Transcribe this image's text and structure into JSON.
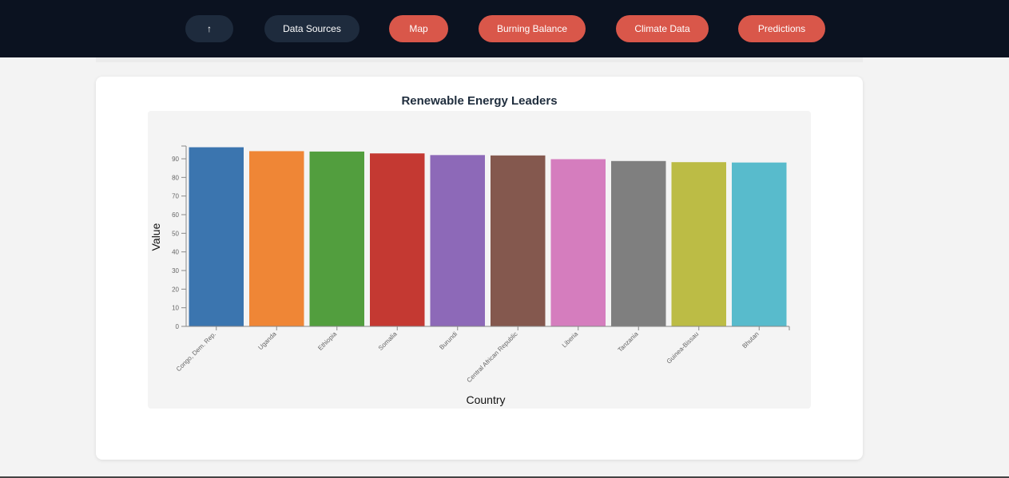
{
  "nav": {
    "up_label": "↑",
    "data_sources_label": "Data Sources",
    "map_label": "Map",
    "burning_balance_label": "Burning Balance",
    "climate_data_label": "Climate Data",
    "predictions_label": "Predictions"
  },
  "colors": {
    "nav_bg": "#0b1220",
    "nav_dark_button": "#1e2b3d",
    "nav_accent_button": "#d9574a",
    "card_bg": "#ffffff",
    "plot_bg": "#f4f4f4"
  },
  "chart_data": {
    "type": "bar",
    "title": "Renewable Energy Leaders",
    "xlabel": "Country",
    "ylabel": "Value",
    "ylim": [
      0,
      96
    ],
    "yticks": [
      0,
      10,
      20,
      30,
      40,
      50,
      60,
      70,
      80,
      90
    ],
    "grid": false,
    "categories": [
      "Congo, Dem. Rep.",
      "Uganda",
      "Ethiopia",
      "Somalia",
      "Burundi",
      "Central African Republic",
      "Liberia",
      "Tanzania",
      "Guinea-Bissau",
      "Bhutan"
    ],
    "values": [
      96.2,
      94.1,
      93.9,
      92.9,
      92.0,
      91.8,
      89.8,
      88.8,
      88.2,
      88.0
    ],
    "colors": [
      "#3b75af",
      "#ef8636",
      "#529e3e",
      "#c43932",
      "#8d69b8",
      "#84584e",
      "#d57dbe",
      "#7f7f7f",
      "#bcbc45",
      "#58bbcc"
    ]
  }
}
